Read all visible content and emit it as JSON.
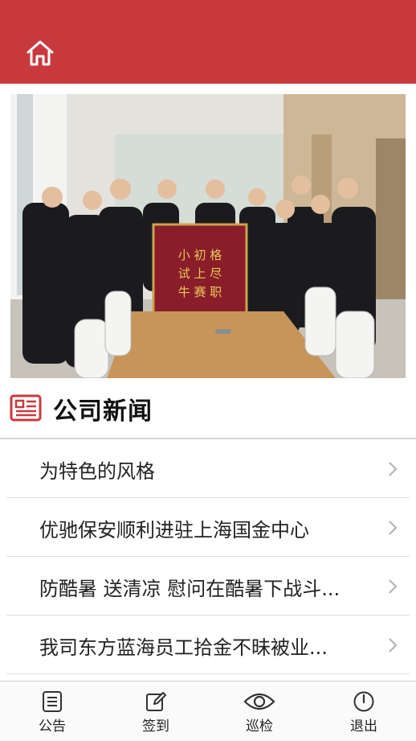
{
  "colors": {
    "brand": "#c8393e",
    "text": "#222222",
    "divider": "#dcdcdc"
  },
  "header": {
    "home_icon": "home-icon"
  },
  "hero": {
    "icon": "team-banner-photo",
    "banner_text": "格尽职守 初上赛 小试牛"
  },
  "section": {
    "icon": "newspaper-icon",
    "title": "公司新闻"
  },
  "news": [
    {
      "title": "为特色的风格"
    },
    {
      "title": "优驰保安顺利进驻上海国金中心"
    },
    {
      "title": "防酷暑 送清凉 慰问在酷暑下战斗..."
    },
    {
      "title": "我司东方蓝海员工拾金不昧被业..."
    }
  ],
  "tabs": [
    {
      "label": "公告",
      "icon": "notice-list-icon"
    },
    {
      "label": "签到",
      "icon": "edit-signin-icon"
    },
    {
      "label": "巡检",
      "icon": "eye-patrol-icon"
    },
    {
      "label": "退出",
      "icon": "power-exit-icon"
    }
  ]
}
